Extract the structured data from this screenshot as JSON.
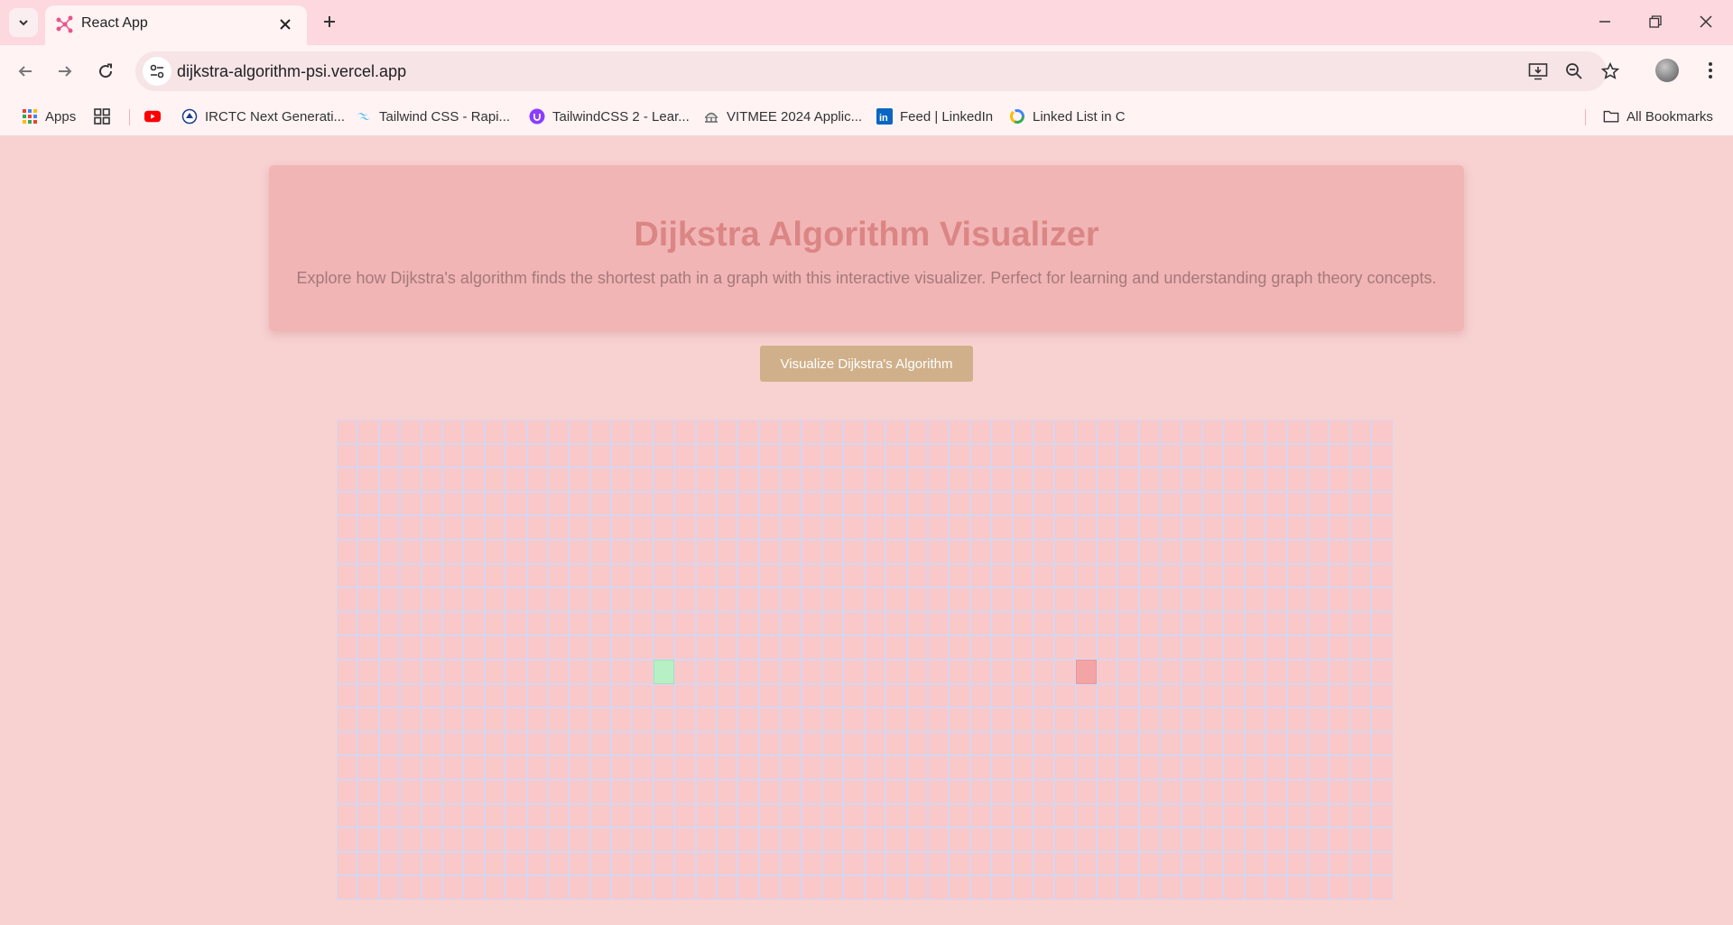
{
  "browser": {
    "tab": {
      "title": "React App",
      "favicon": "react-app-icon"
    },
    "address_bar": {
      "url": "dijkstra-algorithm-psi.vercel.app"
    },
    "bookmarks": [
      {
        "label": "Apps",
        "icon": "apps-grid-icon"
      },
      {
        "label": "",
        "icon": "tab-groups-icon"
      },
      {
        "label": "",
        "icon": "youtube-icon"
      },
      {
        "label": "IRCTC Next Generati...",
        "icon": "irctc-icon"
      },
      {
        "label": "Tailwind CSS - Rapi...",
        "icon": "tailwind-icon"
      },
      {
        "label": "TailwindCSS 2 - Lear...",
        "icon": "course-icon"
      },
      {
        "label": "VITMEE 2024 Applic...",
        "icon": "vit-icon"
      },
      {
        "label": "Feed | LinkedIn",
        "icon": "linkedin-icon"
      },
      {
        "label": "Linked List in C",
        "icon": "chrome-ring-icon"
      }
    ],
    "all_bookmarks_label": "All Bookmarks"
  },
  "page": {
    "title": "Dijkstra Algorithm Visualizer",
    "description": "Explore how Dijkstra's algorithm finds the shortest path in a graph with this interactive visualizer. Perfect for learning and understanding graph theory concepts.",
    "visualize_button": "Visualize Dijkstra's Algorithm"
  },
  "grid": {
    "rows": 20,
    "cols": 50,
    "start_node": {
      "row": 10,
      "col": 15
    },
    "finish_node": {
      "row": 10,
      "col": 35
    }
  },
  "colors": {
    "page_bg": "#f8d1d1",
    "hero_bg": "#f1b5b5",
    "title": "#db8585",
    "button": "#d0b08a",
    "cell": "#fac8c8",
    "cell_border": "#d5d6f0",
    "start": "#b6f0c4",
    "finish": "#f3a4a4"
  }
}
